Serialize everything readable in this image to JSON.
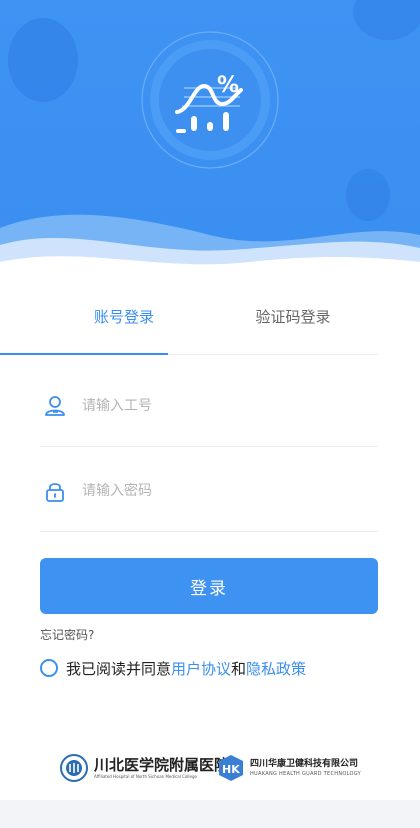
{
  "tabs": {
    "account_login": "账号登录",
    "code_login": "验证码登录"
  },
  "username": {
    "placeholder": "请输入工号"
  },
  "password": {
    "placeholder": "请输入密码"
  },
  "login_button": "登录",
  "forgot_password": "忘记密码?",
  "agreement": {
    "prefix": "我已阅读并同意",
    "user_agreement": "用户协议",
    "and": "和",
    "privacy_policy": "隐私政策"
  },
  "footer": {
    "hospital_name": "川北医学院附属医院",
    "hospital_sub": "Affiliated Hospital of North Sichuan Medical College",
    "company_name": "四川华康卫健科技有限公司",
    "company_sub": "HUAKANG HEALTH GUARD TECHNOLOGY"
  },
  "colors": {
    "primary": "#3a8ff0",
    "header": "#3d92f2"
  }
}
